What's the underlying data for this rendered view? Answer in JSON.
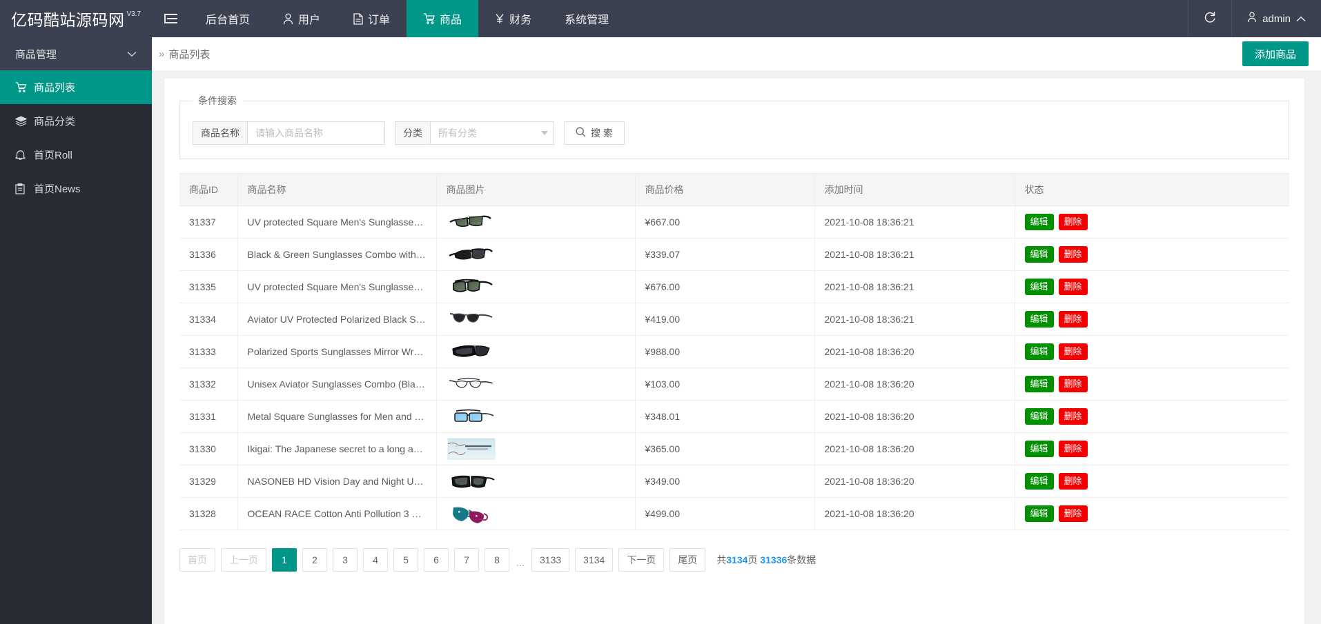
{
  "topbar": {
    "brand_name": "亿码酷站源码网",
    "brand_version": "V3.7",
    "collapse_icon": "hamburger-icon",
    "nav": [
      {
        "label": "后台首页",
        "icon": "",
        "active": false
      },
      {
        "label": "用户",
        "icon": "user-icon",
        "active": false
      },
      {
        "label": "订单",
        "icon": "file-icon",
        "active": false
      },
      {
        "label": "商品",
        "icon": "cart-icon",
        "active": true
      },
      {
        "label": "财务",
        "icon": "yen-icon",
        "active": false
      },
      {
        "label": "系统管理",
        "icon": "",
        "active": false
      }
    ],
    "refresh_label": "",
    "refresh_icon": "refresh-icon",
    "user_label": "admin",
    "user_icon": "user-icon",
    "user_caret": "chevron-up-icon"
  },
  "sidebar": {
    "group_label": "商品管理",
    "group_caret": "chevron-down-icon",
    "items": [
      {
        "label": "商品列表",
        "icon": "cart-icon",
        "active": true
      },
      {
        "label": "商品分类",
        "icon": "layers-icon",
        "active": false
      },
      {
        "label": "首页Roll",
        "icon": "bell-icon",
        "active": false
      },
      {
        "label": "首页News",
        "icon": "clipboard-icon",
        "active": false
      }
    ]
  },
  "breadcrumb": {
    "chevron": "»",
    "text": "商品列表"
  },
  "actions": {
    "add_product_label": "添加商品"
  },
  "search": {
    "legend": "条件搜索",
    "name_label": "商品名称",
    "name_value": "",
    "name_placeholder": "请输入商品名称",
    "category_label": "分类",
    "category_selected": "所有分类",
    "category_options": [
      "所有分类"
    ],
    "search_button_label": "搜 索",
    "search_icon": "search-icon"
  },
  "table": {
    "columns": [
      "商品ID",
      "商品名称",
      "商品图片",
      "商品价格",
      "添加时间",
      "状态"
    ],
    "edit_label": "编辑",
    "delete_label": "删除",
    "rows": [
      {
        "id": "31337",
        "name": "UV protected Square Men's Sunglasses (...",
        "image": "sunglasses-green-lens",
        "price": "¥667.00",
        "time": "2021-10-08 18:36:21"
      },
      {
        "id": "31336",
        "name": "Black & Green Sunglasses Combo with U...",
        "image": "sunglasses-black-wrap",
        "price": "¥339.07",
        "time": "2021-10-08 18:36:21"
      },
      {
        "id": "31335",
        "name": "UV protected Square Men's Sunglasses (...",
        "image": "sunglasses-aviator-green",
        "price": "¥676.00",
        "time": "2021-10-08 18:36:21"
      },
      {
        "id": "31334",
        "name": "Aviator UV Protected Polarized Black Sun...",
        "image": "sunglasses-aviator-metal",
        "price": "¥419.00",
        "time": "2021-10-08 18:36:21"
      },
      {
        "id": "31333",
        "name": "Polarized Sports Sunglasses Mirror Wrap...",
        "image": "sunglasses-sports-black",
        "price": "¥988.00",
        "time": "2021-10-08 18:36:20"
      },
      {
        "id": "31332",
        "name": "Unisex Aviator Sunglasses Combo (Black,...",
        "image": "eyeglasses-clear-thin",
        "price": "¥103.00",
        "time": "2021-10-08 18:36:20"
      },
      {
        "id": "31331",
        "name": "Metal Square Sunglasses for Men and Bo...",
        "image": "sunglasses-blue-square",
        "price": "¥348.01",
        "time": "2021-10-08 18:36:20"
      },
      {
        "id": "31330",
        "name": "Ikigai: The Japanese secret to a long and ...",
        "image": "book-cover-ikigai",
        "price": "¥365.00",
        "time": "2021-10-08 18:36:20"
      },
      {
        "id": "31329",
        "name": "NASONEB HD Vision Day and Night Unis...",
        "image": "sunglasses-fitover-black",
        "price": "¥349.00",
        "time": "2021-10-08 18:36:20"
      },
      {
        "id": "31328",
        "name": "OCEAN RACE Cotton Anti Pollution 3 Lay...",
        "image": "face-masks-teal-magenta",
        "price": "¥499.00",
        "time": "2021-10-08 18:36:20"
      }
    ]
  },
  "pagination": {
    "first_label": "首页",
    "prev_label": "上一页",
    "next_label": "下一页",
    "last_label": "尾页",
    "pages": [
      "1",
      "2",
      "3",
      "4",
      "5",
      "6",
      "7",
      "8"
    ],
    "ellipsis": "...",
    "tail_pages": [
      "3133",
      "3134"
    ],
    "current_page": "1",
    "summary_prefix": "共",
    "total_pages": "3134",
    "summary_mid": "页",
    "total_records": "31336",
    "summary_suffix": "条数据"
  },
  "colors": {
    "accent": "#009688",
    "topbar": "#3c4151",
    "sidebar": "#282b33",
    "edit_green": "#009000",
    "delete_red": "#f40000",
    "link_blue": "#2196f3"
  }
}
